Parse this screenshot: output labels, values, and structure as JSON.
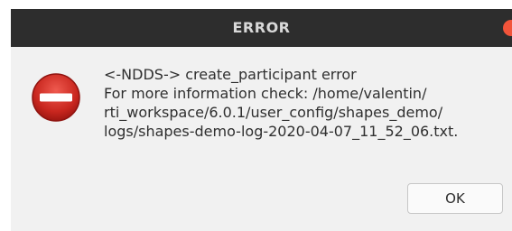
{
  "window": {
    "title": "ERROR"
  },
  "message": {
    "lines": [
      "<-NDDS-> create_participant error",
      " For more information check: /home/valentin/",
      "rti_workspace/6.0.1/user_config/shapes_demo/",
      "logs/shapes-demo-log-2020-04-07_11_52_06.txt."
    ]
  },
  "buttons": {
    "ok_label": "OK"
  },
  "icons": {
    "error": "error-icon",
    "close": "close-icon"
  },
  "colors": {
    "titlebar": "#2d2d2d",
    "dialog_bg": "#f1f1f1",
    "close": "#f2543a",
    "error_red": "#d32f2f"
  }
}
